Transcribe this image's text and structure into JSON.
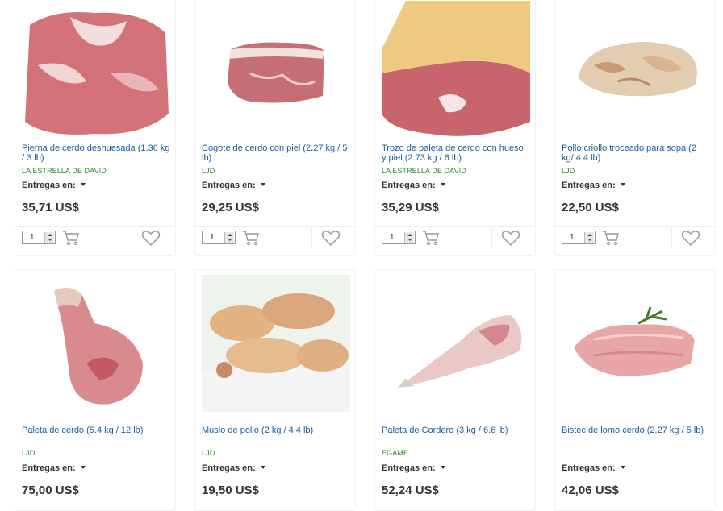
{
  "delivery_label": "Entregas en:",
  "products": [
    {
      "title": "Pierna de cerdo deshuesada (1.36 kg / 3 lb)",
      "brand": "LA ESTRELLA DE DAVID",
      "price": "35,71 US$",
      "qty": "1"
    },
    {
      "title": "Cogote de cerdo con piel (2.27 kg / 5 lb)",
      "brand": "LJD",
      "price": "29,25 US$",
      "qty": "1"
    },
    {
      "title": "Trozo de paleta de cerdo con hueso y piel (2.73 kg / 6 lb)",
      "brand": "LA ESTRELLA DE DAVID",
      "price": "35,29 US$",
      "qty": "1"
    },
    {
      "title": "Pollo criollo troceado para sopa (2 kg/ 4.4 lb)",
      "brand": "LJD",
      "price": "22,50 US$",
      "qty": "1"
    },
    {
      "title": "Paleta de cerdo (5.4 kg / 12 lb)",
      "brand": "LJD",
      "price": "75,00 US$"
    },
    {
      "title": "Muslo de pollo (2 kg / 4.4 lb)",
      "brand": "LJD",
      "price": "19,50 US$"
    },
    {
      "title": "Paleta de Cordero (3 kg / 6.6 lb)",
      "brand": "EGAME",
      "price": "52,24 US$"
    },
    {
      "title": "Bistec de lomo cerdo (2.27 kg / 5 lb)",
      "brand": "",
      "price": "42,06 US$"
    }
  ],
  "icons": {
    "cart": "cart-icon",
    "favorite": "heart-icon",
    "caret": "caret-down-icon"
  },
  "colors": {
    "title_link": "#1a5d9c",
    "brand": "#2a8a2a",
    "price": "#333333"
  }
}
